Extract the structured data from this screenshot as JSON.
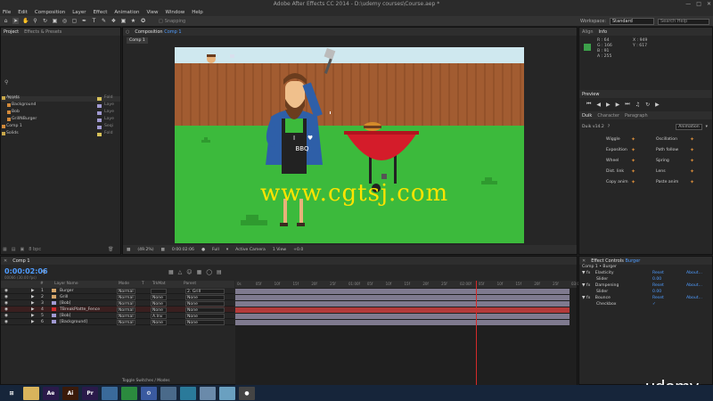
{
  "app": {
    "title": "Adobe After Effects CC 2014 - D:\\udemy courses\\Course.aep *"
  },
  "menu": [
    "File",
    "Edit",
    "Composition",
    "Layer",
    "Effect",
    "Animation",
    "View",
    "Window",
    "Help"
  ],
  "toolbar": {
    "snapping": "Snapping",
    "workspace_label": "Workspace:",
    "workspace_value": "Standard",
    "search_placeholder": "Search Help"
  },
  "project": {
    "tabs": [
      "Project",
      "Effects & Presets"
    ],
    "col_name": "Name",
    "items": [
      {
        "name": "Assets",
        "type": "Fold",
        "indent": 0,
        "color": "#d8c25a"
      },
      {
        "name": "Background",
        "type": "Laye",
        "indent": 1,
        "color": "#a19ad2"
      },
      {
        "name": "Bob",
        "type": "Laye",
        "indent": 1,
        "color": "#a19ad2"
      },
      {
        "name": "GrillNBurger",
        "type": "Laye",
        "indent": 1,
        "color": "#a19ad2"
      },
      {
        "name": "Comp 1",
        "type": "Seqi",
        "indent": 0,
        "color": "#a19ad2"
      },
      {
        "name": "Solids",
        "type": "Fold",
        "indent": 0,
        "color": "#d8c25a"
      }
    ],
    "bpc": "8 bpc"
  },
  "composition": {
    "tab": "Composition",
    "tab_link": "Comp 1",
    "subtab": "Comp 1",
    "zoom": "(49.2%)",
    "timecode": "0:00:02:06",
    "resolution": "Full",
    "camera": "Active Camera",
    "views": "1 View",
    "exposure": "+0.0",
    "bbq_text_top": "I",
    "bbq_text_bottom": "BBQ"
  },
  "info": {
    "tabs": [
      "Align",
      "Info"
    ],
    "r": "R : 64",
    "g": "G : 166",
    "b": "B : 91",
    "a": "A : 255",
    "x": "X : 949",
    "y": "Y : 617"
  },
  "preview": {
    "tab": "Preview"
  },
  "duik": {
    "tabs": [
      "Duik",
      "Character",
      "Paragraph"
    ],
    "version": "Duik v14.2",
    "help": "?",
    "mode": "Animation",
    "buttons": [
      {
        "left": "Wiggle",
        "right": "Oscillation"
      },
      {
        "left": "Exposition",
        "right": "Path follow"
      },
      {
        "left": "Wheel",
        "right": "Spring"
      },
      {
        "left": "Dist. link",
        "right": "Lens"
      },
      {
        "left": "Copy anim",
        "right": "Paste anim"
      }
    ]
  },
  "timeline": {
    "tab": "Comp 1",
    "timecode": "0:00:02:06",
    "fps": "00066 (30.00 fps)",
    "headers": {
      "num": "#",
      "name": "Layer Name",
      "mode": "Mode",
      "t": "T",
      "trkmat": "TrkMat",
      "parent": "Parent"
    },
    "layers": [
      {
        "num": "1",
        "name": "Burger",
        "mode": "Normal",
        "trkmat": "",
        "parent": "2. Grill",
        "color": "#d3a46a",
        "bar": "#7f7a8f"
      },
      {
        "num": "2",
        "name": "Grill",
        "mode": "Normal",
        "trkmat": "None",
        "parent": "None",
        "color": "#d3a46a",
        "bar": "#7f7a8f"
      },
      {
        "num": "3",
        "name": "[Bob]",
        "mode": "Normal",
        "trkmat": "None",
        "parent": "None",
        "color": "#a19ad2",
        "bar": "#7f7a8f"
      },
      {
        "num": "4",
        "name": "TBreakPlatte_Fence",
        "mode": "Normal",
        "trkmat": "None",
        "parent": "None",
        "color": "#cc2a2a",
        "bar": "#b43a3a"
      },
      {
        "num": "5",
        "name": "[Bob]",
        "mode": "Normal",
        "trkmat": "A.Inv",
        "parent": "None",
        "color": "#a19ad2",
        "bar": "#7f7a8f"
      },
      {
        "num": "6",
        "name": "[Background]",
        "mode": "Normal",
        "trkmat": "None",
        "parent": "None",
        "color": "#a19ad2",
        "bar": "#7f7a8f"
      }
    ],
    "ruler_labels": [
      "0s",
      "05f",
      "10f",
      "15f",
      "20f",
      "25f",
      "01:00f",
      "05f",
      "10f",
      "15f",
      "20f",
      "25f",
      "02:00f",
      "05f",
      "10f",
      "15f",
      "20f",
      "25f",
      "03:0"
    ],
    "playhead_fraction": 0.72,
    "toggle_label": "Toggle Switches / Modes"
  },
  "effect_controls": {
    "tab": "Effect Controls",
    "tab_link": "Burger",
    "target": "Comp 1 • Burger",
    "effects": [
      {
        "name": "Elasticity",
        "reset": "Reset",
        "about": "About..."
      },
      {
        "name": "Slider",
        "value": "0.00",
        "sub": true
      },
      {
        "name": "Dampening",
        "reset": "Reset",
        "about": "About..."
      },
      {
        "name": "Slider",
        "value": "0.00",
        "sub": true
      },
      {
        "name": "Bounce",
        "reset": "Reset",
        "about": "About..."
      },
      {
        "name": "Checkbox",
        "value": "✓",
        "sub": true
      }
    ]
  },
  "watermark": "www.cgtsj.com",
  "brand": "udemy",
  "taskbar": [
    {
      "label": "⊞",
      "color": "#16253a"
    },
    {
      "label": "",
      "color": "#d9b45c"
    },
    {
      "label": "Ae",
      "color": "#2a1a4a"
    },
    {
      "label": "Ai",
      "color": "#3a1a0a"
    },
    {
      "label": "Pr",
      "color": "#2a1a4a"
    },
    {
      "label": "",
      "color": "#3a6a9a"
    },
    {
      "label": "",
      "color": "#2b8a3e"
    },
    {
      "label": "⚙",
      "color": "#3a5aa0"
    },
    {
      "label": "",
      "color": "#4a6a8a"
    },
    {
      "label": "",
      "color": "#2a7a9a"
    },
    {
      "label": "",
      "color": "#6a8aaa"
    },
    {
      "label": "",
      "color": "#6aa0c0"
    },
    {
      "label": "●",
      "color": "#444"
    }
  ]
}
